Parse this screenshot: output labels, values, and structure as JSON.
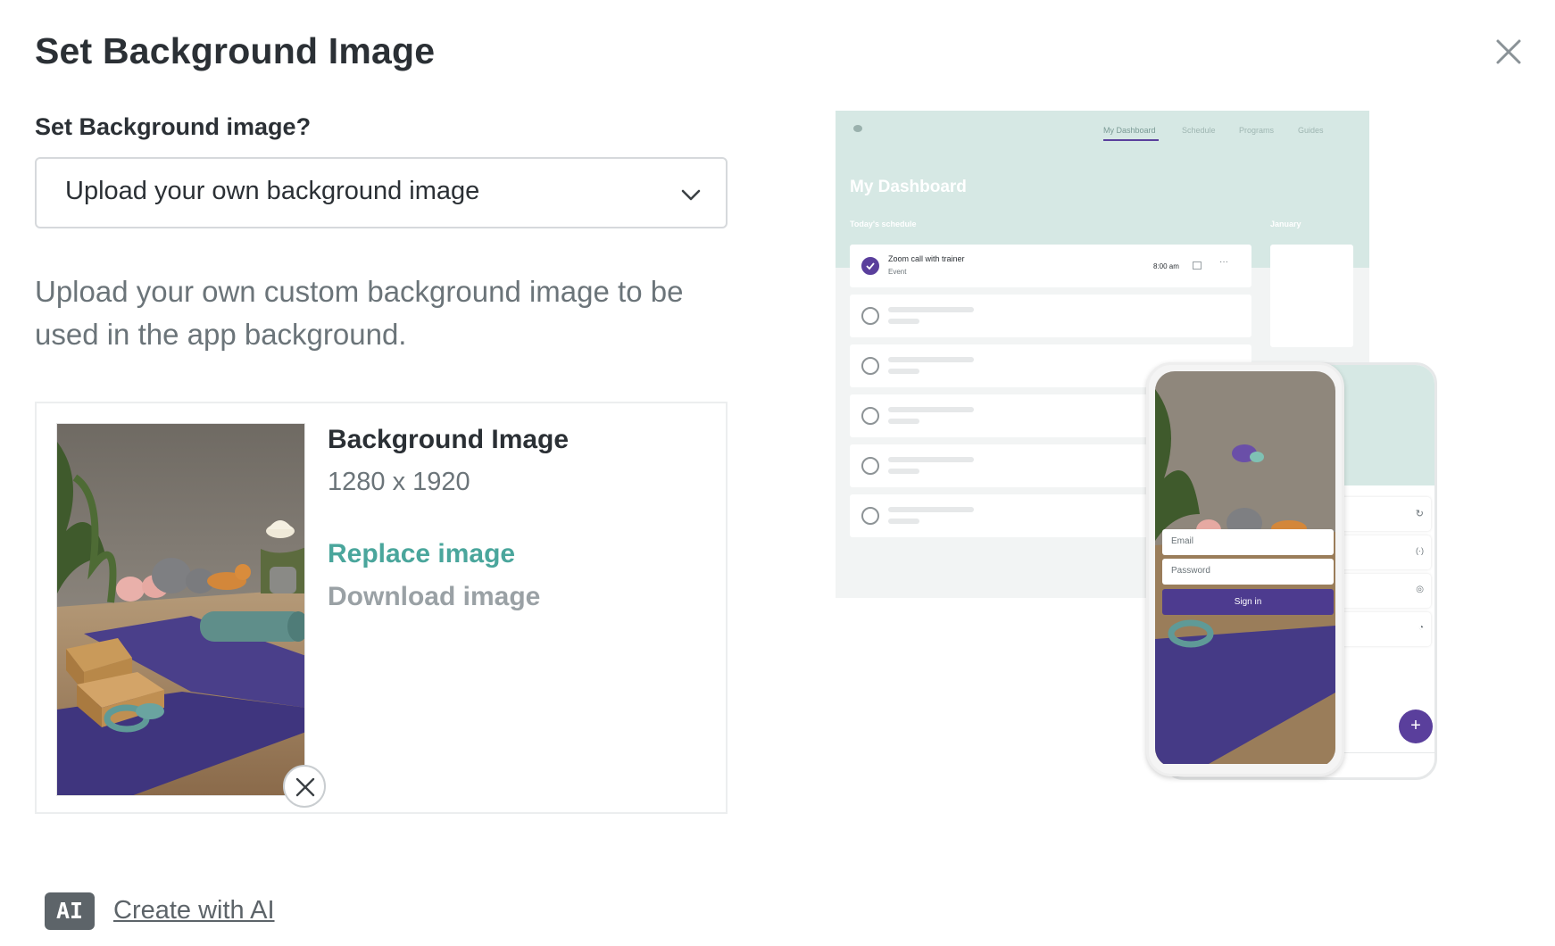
{
  "dialog": {
    "title": "Set Background Image",
    "question_label": "Set Background image?",
    "select_value": "Upload your own background image",
    "description": "Upload your own custom background image to be used in the app background."
  },
  "image_card": {
    "title": "Background Image",
    "dimensions": "1280 x 1920",
    "replace_label": "Replace image",
    "download_label": "Download image"
  },
  "ai": {
    "badge": "AI",
    "link_label": "Create with AI"
  },
  "preview": {
    "desktop": {
      "nav": [
        "My Dashboard",
        "Schedule",
        "Programs",
        "Guides"
      ],
      "title": "My Dashboard",
      "schedule_label": "Today's schedule",
      "calendar_label": "January",
      "first_item_title": "Zoom call with trainer",
      "first_item_type": "Event",
      "first_item_time": "8:00 am"
    },
    "phone": {
      "email_placeholder": "Email",
      "password_placeholder": "Password",
      "sign_in_label": "Sign in",
      "fab_label": "+"
    }
  },
  "colors": {
    "accent": "#4aa69c",
    "mint": "#d6e8e4",
    "purple": "#4d3b8f"
  }
}
